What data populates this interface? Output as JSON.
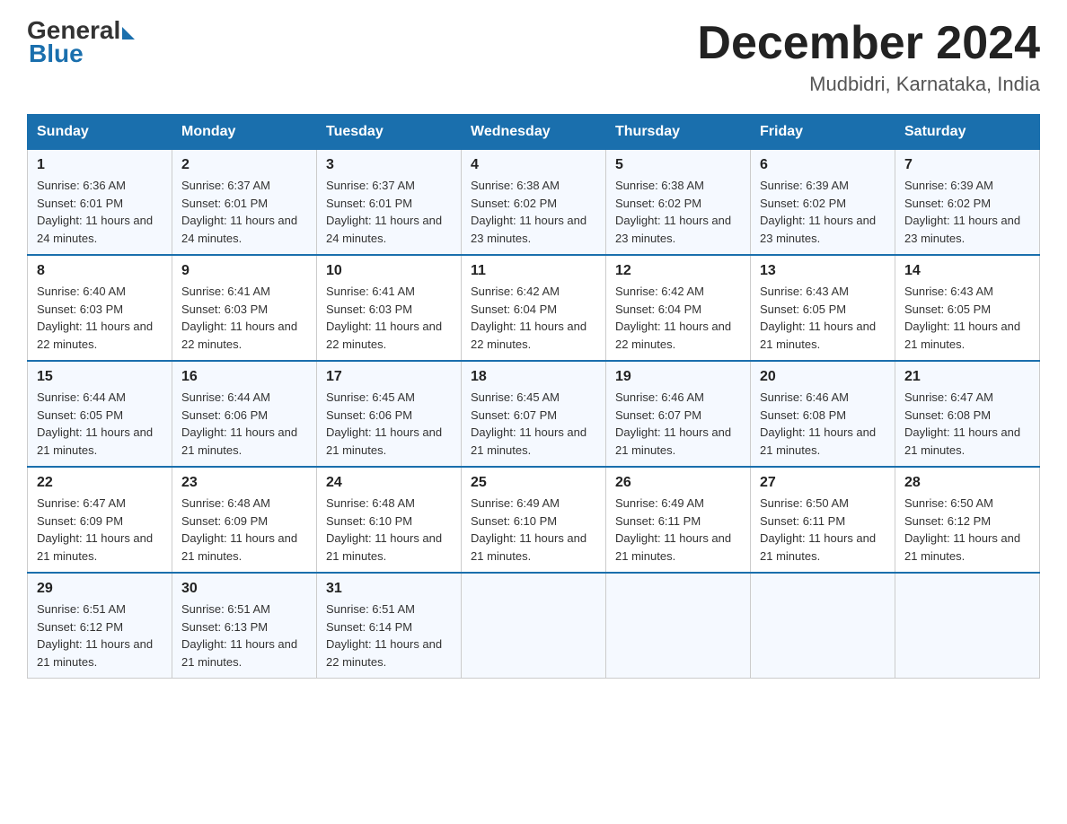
{
  "logo": {
    "general": "General",
    "blue": "Blue"
  },
  "title": "December 2024",
  "location": "Mudbidri, Karnataka, India",
  "days_header": [
    "Sunday",
    "Monday",
    "Tuesday",
    "Wednesday",
    "Thursday",
    "Friday",
    "Saturday"
  ],
  "weeks": [
    [
      {
        "day": "1",
        "sunrise": "6:36 AM",
        "sunset": "6:01 PM",
        "daylight": "11 hours and 24 minutes."
      },
      {
        "day": "2",
        "sunrise": "6:37 AM",
        "sunset": "6:01 PM",
        "daylight": "11 hours and 24 minutes."
      },
      {
        "day": "3",
        "sunrise": "6:37 AM",
        "sunset": "6:01 PM",
        "daylight": "11 hours and 24 minutes."
      },
      {
        "day": "4",
        "sunrise": "6:38 AM",
        "sunset": "6:02 PM",
        "daylight": "11 hours and 23 minutes."
      },
      {
        "day": "5",
        "sunrise": "6:38 AM",
        "sunset": "6:02 PM",
        "daylight": "11 hours and 23 minutes."
      },
      {
        "day": "6",
        "sunrise": "6:39 AM",
        "sunset": "6:02 PM",
        "daylight": "11 hours and 23 minutes."
      },
      {
        "day": "7",
        "sunrise": "6:39 AM",
        "sunset": "6:02 PM",
        "daylight": "11 hours and 23 minutes."
      }
    ],
    [
      {
        "day": "8",
        "sunrise": "6:40 AM",
        "sunset": "6:03 PM",
        "daylight": "11 hours and 22 minutes."
      },
      {
        "day": "9",
        "sunrise": "6:41 AM",
        "sunset": "6:03 PM",
        "daylight": "11 hours and 22 minutes."
      },
      {
        "day": "10",
        "sunrise": "6:41 AM",
        "sunset": "6:03 PM",
        "daylight": "11 hours and 22 minutes."
      },
      {
        "day": "11",
        "sunrise": "6:42 AM",
        "sunset": "6:04 PM",
        "daylight": "11 hours and 22 minutes."
      },
      {
        "day": "12",
        "sunrise": "6:42 AM",
        "sunset": "6:04 PM",
        "daylight": "11 hours and 22 minutes."
      },
      {
        "day": "13",
        "sunrise": "6:43 AM",
        "sunset": "6:05 PM",
        "daylight": "11 hours and 21 minutes."
      },
      {
        "day": "14",
        "sunrise": "6:43 AM",
        "sunset": "6:05 PM",
        "daylight": "11 hours and 21 minutes."
      }
    ],
    [
      {
        "day": "15",
        "sunrise": "6:44 AM",
        "sunset": "6:05 PM",
        "daylight": "11 hours and 21 minutes."
      },
      {
        "day": "16",
        "sunrise": "6:44 AM",
        "sunset": "6:06 PM",
        "daylight": "11 hours and 21 minutes."
      },
      {
        "day": "17",
        "sunrise": "6:45 AM",
        "sunset": "6:06 PM",
        "daylight": "11 hours and 21 minutes."
      },
      {
        "day": "18",
        "sunrise": "6:45 AM",
        "sunset": "6:07 PM",
        "daylight": "11 hours and 21 minutes."
      },
      {
        "day": "19",
        "sunrise": "6:46 AM",
        "sunset": "6:07 PM",
        "daylight": "11 hours and 21 minutes."
      },
      {
        "day": "20",
        "sunrise": "6:46 AM",
        "sunset": "6:08 PM",
        "daylight": "11 hours and 21 minutes."
      },
      {
        "day": "21",
        "sunrise": "6:47 AM",
        "sunset": "6:08 PM",
        "daylight": "11 hours and 21 minutes."
      }
    ],
    [
      {
        "day": "22",
        "sunrise": "6:47 AM",
        "sunset": "6:09 PM",
        "daylight": "11 hours and 21 minutes."
      },
      {
        "day": "23",
        "sunrise": "6:48 AM",
        "sunset": "6:09 PM",
        "daylight": "11 hours and 21 minutes."
      },
      {
        "day": "24",
        "sunrise": "6:48 AM",
        "sunset": "6:10 PM",
        "daylight": "11 hours and 21 minutes."
      },
      {
        "day": "25",
        "sunrise": "6:49 AM",
        "sunset": "6:10 PM",
        "daylight": "11 hours and 21 minutes."
      },
      {
        "day": "26",
        "sunrise": "6:49 AM",
        "sunset": "6:11 PM",
        "daylight": "11 hours and 21 minutes."
      },
      {
        "day": "27",
        "sunrise": "6:50 AM",
        "sunset": "6:11 PM",
        "daylight": "11 hours and 21 minutes."
      },
      {
        "day": "28",
        "sunrise": "6:50 AM",
        "sunset": "6:12 PM",
        "daylight": "11 hours and 21 minutes."
      }
    ],
    [
      {
        "day": "29",
        "sunrise": "6:51 AM",
        "sunset": "6:12 PM",
        "daylight": "11 hours and 21 minutes."
      },
      {
        "day": "30",
        "sunrise": "6:51 AM",
        "sunset": "6:13 PM",
        "daylight": "11 hours and 21 minutes."
      },
      {
        "day": "31",
        "sunrise": "6:51 AM",
        "sunset": "6:14 PM",
        "daylight": "11 hours and 22 minutes."
      },
      null,
      null,
      null,
      null
    ]
  ]
}
